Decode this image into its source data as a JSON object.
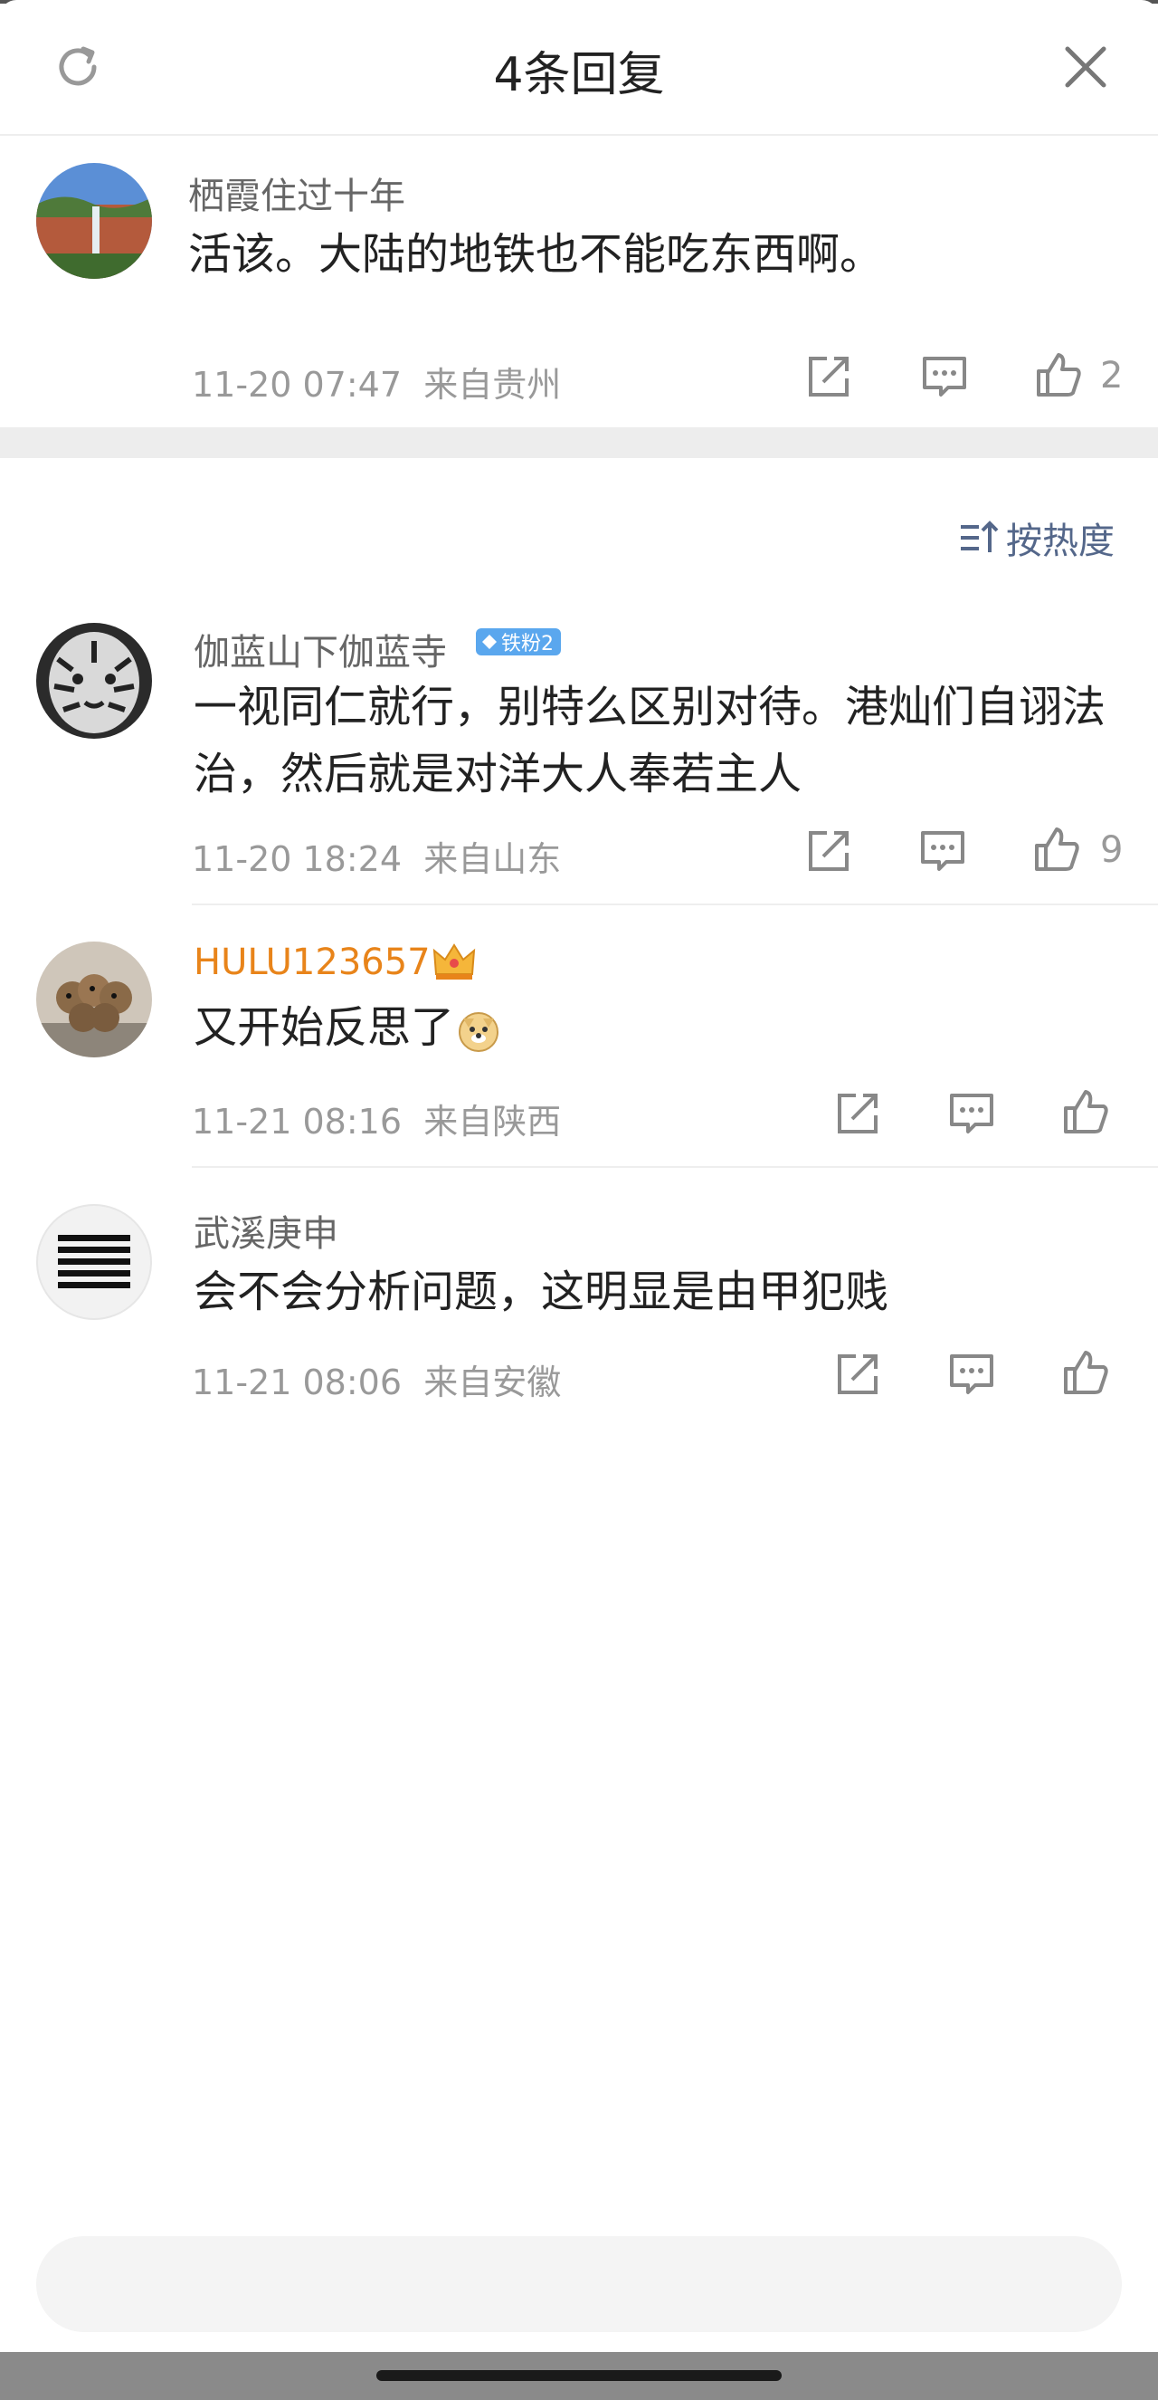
{
  "header": {
    "title": "4条回复",
    "refresh_icon": "refresh-icon",
    "close_icon": "close-icon"
  },
  "root_comment": {
    "username": "栖霞住过十年",
    "text": "活该。大陆的地铁也不能吃东西啊。",
    "time": "11-20 07:47",
    "location": "来自贵州",
    "likes": "2"
  },
  "sort": {
    "label": "按热度",
    "icon": "sort-icon"
  },
  "replies": [
    {
      "username": "伽蓝山下伽蓝寺",
      "badge": "铁粉2",
      "text_line1": "一视同仁就行，别特么区别对待。港灿们自诩法",
      "text_line2": "治，然后就是对洋大人奉若主人",
      "time": "11-20 18:24",
      "location": "来自山东",
      "likes": "9"
    },
    {
      "username": "HULU123657",
      "username_color": "#e8841a",
      "text": "又开始反思了",
      "time": "11-21 08:16",
      "location": "来自陕西"
    },
    {
      "username": "武溪庚申",
      "text": "会不会分析问题，这明显是由甲犯贱",
      "time": "11-21 08:06",
      "location": "来自安徽"
    }
  ],
  "colors": {
    "link_blue": "#54678a",
    "vip_orange": "#e8841a",
    "badge_blue": "#5aa7ee"
  }
}
